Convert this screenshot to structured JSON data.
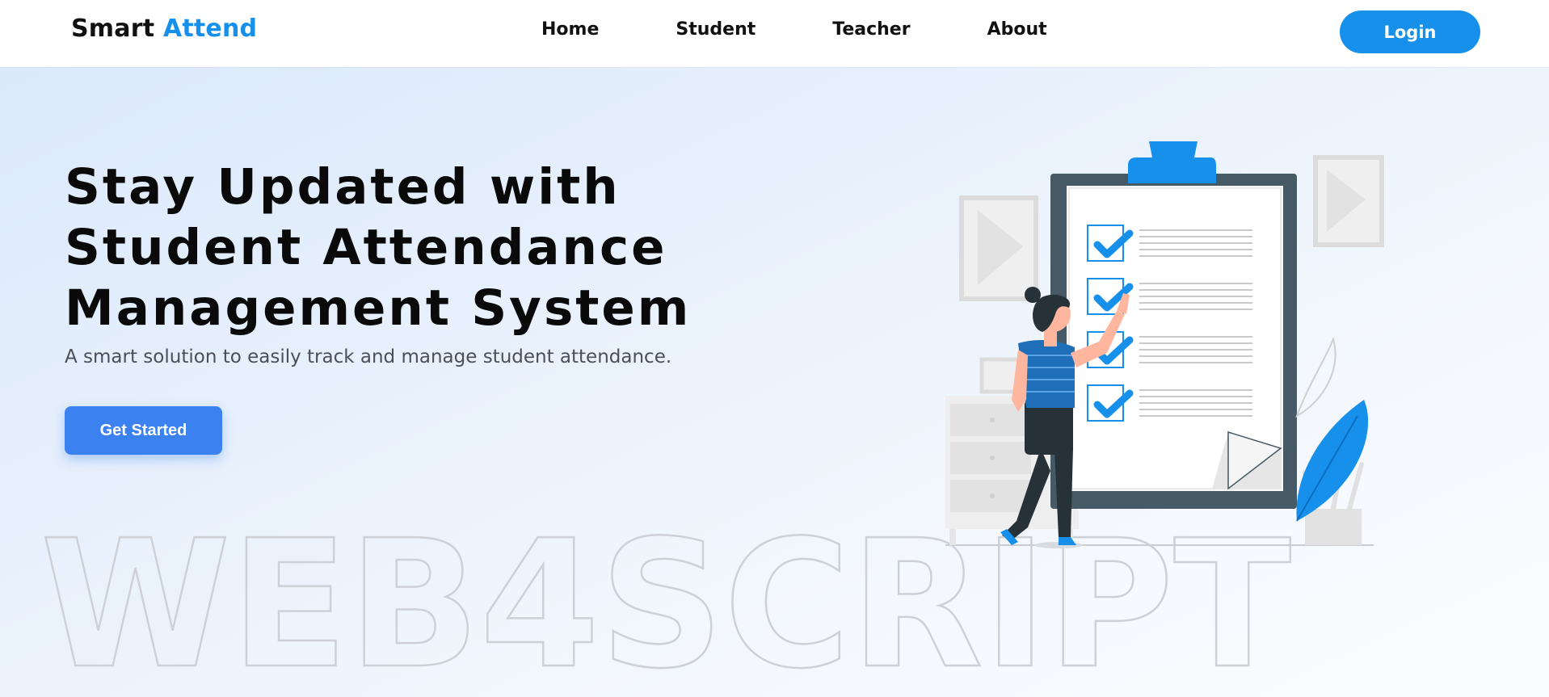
{
  "brand": {
    "name": "Smart",
    "accent": "Attend"
  },
  "nav": {
    "items": [
      {
        "label": "Home"
      },
      {
        "label": "Student"
      },
      {
        "label": "Teacher"
      },
      {
        "label": "About"
      }
    ],
    "login_label": "Login"
  },
  "hero": {
    "headline_lines": [
      "Stay Updated with",
      "Student Attendance",
      "Management System"
    ],
    "subtitle": "A smart solution to easily track and manage student attendance.",
    "cta_label": "Get Started",
    "watermark": "WEB4SCRIPT"
  },
  "colors": {
    "accent": "#1690ea",
    "cta": "#3b82f0",
    "hero_gradient_start": "#dbe9fb",
    "text_dark": "#0a0a0a"
  },
  "icons": {
    "illustration": "attendance-checklist-illustration"
  }
}
